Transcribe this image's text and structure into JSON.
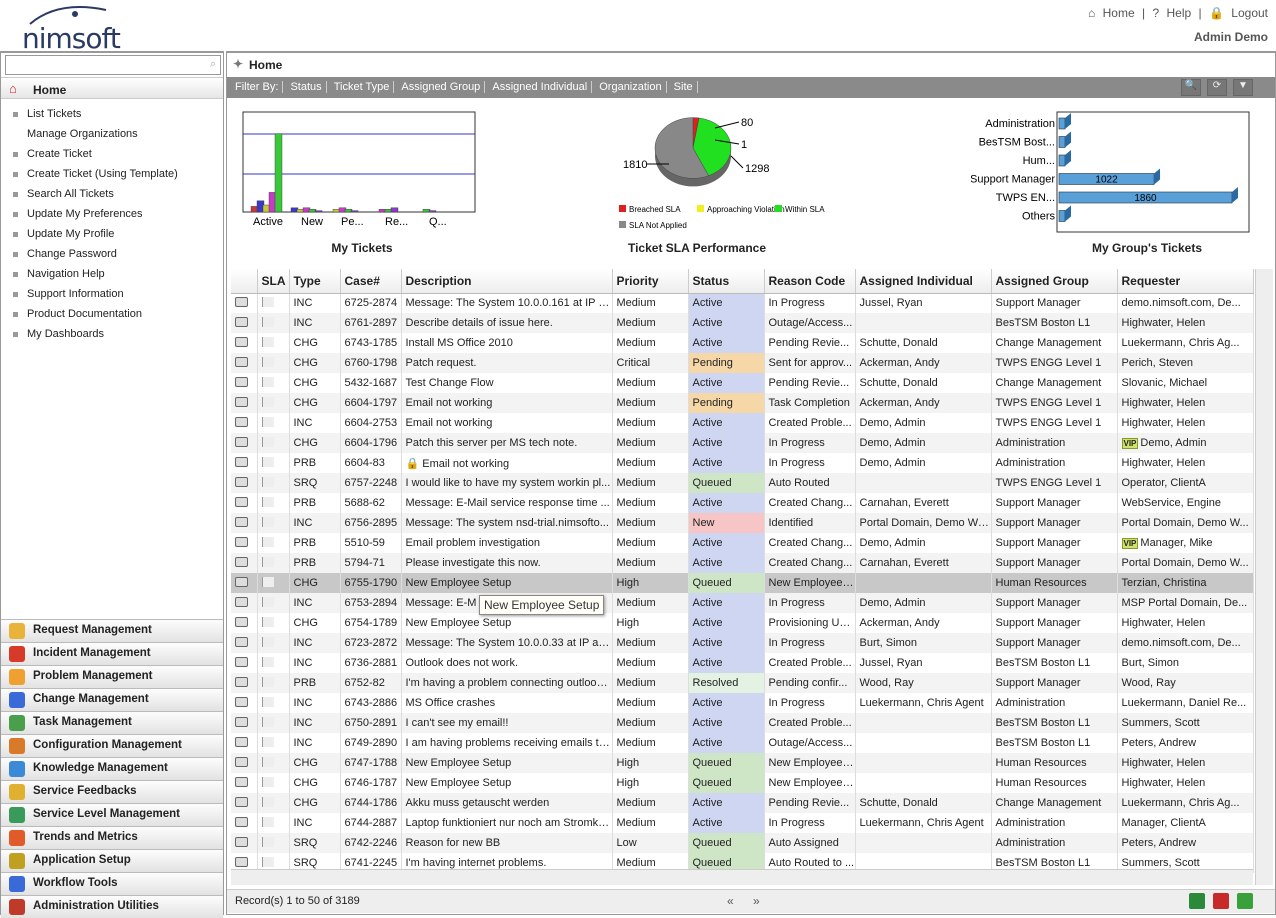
{
  "brand": {
    "logo_text": "nimsoft"
  },
  "toplinks": {
    "home": "Home",
    "help": "Help",
    "logout": "Logout",
    "sep": "|",
    "user": "Admin Demo"
  },
  "sidebar": {
    "home": "Home",
    "items": [
      "List Tickets",
      "Manage Organizations",
      "Create Ticket",
      "Create Ticket (Using Template)",
      "Search All Tickets",
      "Update My Preferences",
      "Update My Profile",
      "Change Password",
      "Navigation Help",
      "Support Information",
      "Product Documentation",
      "My Dashboards"
    ],
    "modules": [
      {
        "label": "Request Management",
        "color": "#e8b338"
      },
      {
        "label": "Incident Management",
        "color": "#d83a2a"
      },
      {
        "label": "Problem Management",
        "color": "#f0a030"
      },
      {
        "label": "Change Management",
        "color": "#3a6ad8"
      },
      {
        "label": "Task Management",
        "color": "#4aa04a"
      },
      {
        "label": "Configuration Management",
        "color": "#d87a2a"
      },
      {
        "label": "Knowledge Management",
        "color": "#3a8ad8"
      },
      {
        "label": "Service Feedbacks",
        "color": "#e0b030"
      },
      {
        "label": "Service Level Management",
        "color": "#3a9a5a"
      },
      {
        "label": "Trends and Metrics",
        "color": "#e05a2a"
      },
      {
        "label": "Application Setup",
        "color": "#c0a020"
      },
      {
        "label": "Workflow Tools",
        "color": "#3a6ad8"
      },
      {
        "label": "Administration Utilities",
        "color": "#c03a2a"
      }
    ]
  },
  "main": {
    "title": "Home",
    "filter_label": "Filter By:",
    "filters": [
      "Status",
      "Ticket Type",
      "Assigned Group",
      "Assigned Individual",
      "Organization",
      "Site"
    ]
  },
  "chart_data": [
    {
      "type": "bar",
      "title": "My Tickets",
      "categories": [
        "Active",
        "New",
        "Pe...",
        "Re...",
        "Q..."
      ],
      "note": "3D clustered bars; values read approximately",
      "ylim": [
        0,
        100
      ]
    },
    {
      "type": "pie",
      "title": "Ticket SLA Performance",
      "slices": [
        {
          "name": "Breached SLA",
          "value": 80,
          "color": "#e02020"
        },
        {
          "name": "Approaching Violation",
          "value": 1,
          "color": "#f0f020"
        },
        {
          "name": "Within SLA",
          "value": 1298,
          "color": "#20e020"
        },
        {
          "name": "SLA Not Applied",
          "value": 1810,
          "color": "#888888"
        }
      ],
      "labels": [
        "80",
        "1",
        "1298",
        "1810"
      ]
    },
    {
      "type": "bar",
      "title": "My Group's Tickets",
      "orientation": "horizontal",
      "categories": [
        "Administration",
        "BesTSM Bost...",
        "Hum...",
        "Support Manager",
        "TWPS EN...",
        "Others"
      ],
      "values": [
        null,
        null,
        null,
        1022,
        1860,
        null
      ],
      "value_labels": [
        "",
        "",
        "",
        "1022",
        "1860",
        ""
      ]
    }
  ],
  "table": {
    "headers": [
      "",
      "SLA",
      "Type",
      "Case#",
      "Description",
      "Priority",
      "Status",
      "Reason Code",
      "Assigned Individual",
      "Assigned Group",
      "Requester"
    ],
    "rows": [
      [
        "INC",
        "6725-2874",
        "Message: The System 10.0.0.161 at IP a...",
        "Medium",
        "Active",
        "In Progress",
        "Jussel, Ryan",
        "Support Manager",
        "demo.nimsoft.com, De..."
      ],
      [
        "INC",
        "6761-2897",
        "Describe details of issue here.",
        "Medium",
        "Active",
        "Outage/Access...",
        "",
        "BesTSM Boston L1",
        "Highwater, Helen"
      ],
      [
        "CHG",
        "6743-1785",
        "Install MS Office 2010",
        "Medium",
        "Active",
        "Pending Revie...",
        "Schutte, Donald",
        "Change Management",
        "Luekermann, Chris Ag..."
      ],
      [
        "CHG",
        "6760-1798",
        "Patch request.",
        "Critical",
        "Pending",
        "Sent for approv...",
        "Ackerman, Andy",
        "TWPS ENGG Level 1",
        "Perich, Steven"
      ],
      [
        "CHG",
        "5432-1687",
        "Test Change Flow",
        "Medium",
        "Active",
        "Pending Revie...",
        "Schutte, Donald",
        "Change Management",
        "Slovanic, Michael"
      ],
      [
        "CHG",
        "6604-1797",
        "Email not working",
        "Medium",
        "Pending",
        "Task Completion",
        "Ackerman, Andy",
        "TWPS ENGG Level 1",
        "Highwater, Helen"
      ],
      [
        "INC",
        "6604-2753",
        "Email not working",
        "Medium",
        "Active",
        "Created Proble...",
        "Demo, Admin",
        "TWPS ENGG Level 1",
        "Highwater, Helen"
      ],
      [
        "CHG",
        "6604-1796",
        "Patch this server per MS tech note.",
        "Medium",
        "Active",
        "In Progress",
        "Demo, Admin",
        "Administration",
        "Demo, Admin"
      ],
      [
        "PRB",
        "6604-83",
        "Email not working",
        "Medium",
        "Active",
        "In Progress",
        "Demo, Admin",
        "Administration",
        "Highwater, Helen"
      ],
      [
        "SRQ",
        "6757-2248",
        "I would like to have my system workin pl...",
        "Medium",
        "Queued",
        "Auto Routed",
        "",
        "TWPS ENGG Level 1",
        "Operator, ClientA"
      ],
      [
        "PRB",
        "5688-62",
        "Message: E-Mail service response time ...",
        "Medium",
        "Active",
        "Created Chang...",
        "Carnahan, Everett",
        "Support Manager",
        "WebService, Engine"
      ],
      [
        "INC",
        "6756-2895",
        "Message: The system nsd-trial.nimsofto...",
        "Medium",
        "New",
        "Identified",
        "Portal Domain, Demo We...",
        "Support Manager",
        "Portal Domain, Demo W..."
      ],
      [
        "PRB",
        "5510-59",
        "Email problem investigation",
        "Medium",
        "Active",
        "Created Chang...",
        "Demo, Admin",
        "Support Manager",
        "Manager, Mike"
      ],
      [
        "PRB",
        "5794-71",
        "Please investigate this now.",
        "Medium",
        "Active",
        "Created Chang...",
        "Carnahan, Everett",
        "Support Manager",
        "Portal Domain, Demo W..."
      ],
      [
        "CHG",
        "6755-1790",
        "New Employee Setup",
        "High",
        "Queued",
        "New Employee ...",
        "",
        "Human Resources",
        "Terzian, Christina"
      ],
      [
        "INC",
        "6753-2894",
        "Message: E-M",
        "Medium",
        "Active",
        "In Progress",
        "Demo, Admin",
        "Support Manager",
        "MSP Portal Domain, De..."
      ],
      [
        "CHG",
        "6754-1789",
        "New Employee Setup",
        "High",
        "Active",
        "Provisioning User",
        "Ackerman, Andy",
        "Support Manager",
        "Highwater, Helen"
      ],
      [
        "INC",
        "6723-2872",
        "Message: The System 10.0.0.33 at IP ad...",
        "Medium",
        "Active",
        "In Progress",
        "Burt, Simon",
        "Support Manager",
        "demo.nimsoft.com, De..."
      ],
      [
        "INC",
        "6736-2881",
        "Outlook does not work.",
        "Medium",
        "Active",
        "Created Proble...",
        "Jussel, Ryan",
        "BesTSM Boston L1",
        "Burt, Simon"
      ],
      [
        "PRB",
        "6752-82",
        "I'm having a problem connecting outlook t...",
        "Medium",
        "Resolved",
        "Pending confir...",
        "Wood, Ray",
        "Support Manager",
        "Wood, Ray"
      ],
      [
        "INC",
        "6743-2886",
        "MS Office crashes",
        "Medium",
        "Active",
        "In Progress",
        "Luekermann, Chris Agent",
        "Administration",
        "Luekermann, Daniel Re..."
      ],
      [
        "INC",
        "6750-2891",
        "I can't see my email!!",
        "Medium",
        "Active",
        "Created Proble...",
        "",
        "BesTSM Boston L1",
        "Summers, Scott"
      ],
      [
        "INC",
        "6749-2890",
        "I am having problems receiving emails to ...",
        "Medium",
        "Active",
        "Outage/Access...",
        "",
        "BesTSM Boston L1",
        "Peters, Andrew"
      ],
      [
        "CHG",
        "6747-1788",
        "New Employee Setup",
        "High",
        "Queued",
        "New Employee ...",
        "",
        "Human Resources",
        "Highwater, Helen"
      ],
      [
        "CHG",
        "6746-1787",
        "New Employee Setup",
        "High",
        "Queued",
        "New Employee ...",
        "",
        "Human Resources",
        "Highwater, Helen"
      ],
      [
        "CHG",
        "6744-1786",
        "Akku muss getauscht werden",
        "Medium",
        "Active",
        "Pending Revie...",
        "Schutte, Donald",
        "Change Management",
        "Luekermann, Chris Ag..."
      ],
      [
        "INC",
        "6744-2887",
        "Laptop funktioniert nur noch am Stromka...",
        "Medium",
        "Active",
        "In Progress",
        "Luekermann, Chris Agent",
        "Administration",
        "Manager, ClientA"
      ],
      [
        "SRQ",
        "6742-2246",
        "Reason for new BB",
        "Low",
        "Queued",
        "Auto Assigned",
        "",
        "Administration",
        "Peters, Andrew"
      ],
      [
        "SRQ",
        "6741-2245",
        "I'm having internet problems.",
        "Medium",
        "Queued",
        "Auto Routed to ...",
        "",
        "BesTSM Boston L1",
        "Summers, Scott"
      ]
    ],
    "vip_rows": [
      7,
      12
    ],
    "lock_rows": [
      8
    ],
    "selected_row": 14,
    "vip_label": "VIP",
    "tooltip": "New Employee Setup"
  },
  "footer": {
    "records": "Record(s) 1 to 50 of 3189",
    "prev": "«",
    "next": "»"
  }
}
